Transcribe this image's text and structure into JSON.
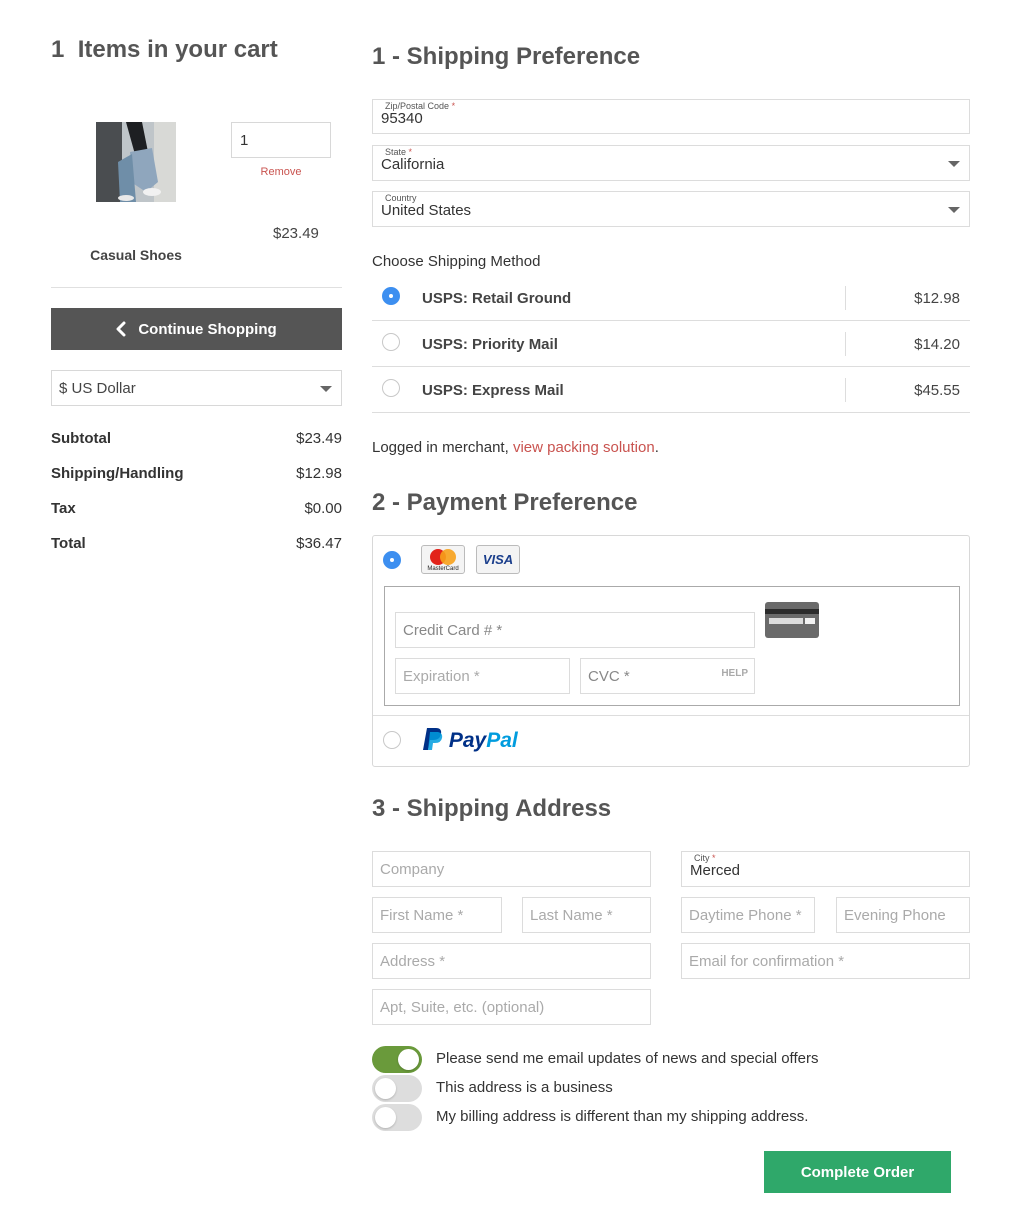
{
  "cart": {
    "count": "1",
    "title_text": "Items in your cart",
    "item": {
      "name": "Casual Shoes",
      "quantity": "1",
      "remove_label": "Remove",
      "price": "$23.49"
    },
    "continue_label": "Continue Shopping",
    "currency": "$ US Dollar",
    "totals": [
      {
        "label": "Subtotal",
        "value": "$23.49"
      },
      {
        "label": "Shipping/Handling",
        "value": "$12.98"
      },
      {
        "label": "Tax",
        "value": "$0.00"
      },
      {
        "label": "Total",
        "value": "$36.47"
      }
    ]
  },
  "shipping_pref": {
    "title": "1 - Shipping Preference",
    "zip": {
      "label": "Zip/Postal Code",
      "value": "95340"
    },
    "state": {
      "label": "State",
      "value": "California"
    },
    "country": {
      "label": "Country",
      "value": "United States"
    },
    "method_title": "Choose Shipping Method",
    "methods": [
      {
        "name": "USPS: Retail Ground",
        "price": "$12.98",
        "selected": true
      },
      {
        "name": "USPS: Priority Mail",
        "price": "$14.20",
        "selected": false
      },
      {
        "name": "USPS: Express Mail",
        "price": "$45.55",
        "selected": false
      }
    ],
    "merchant_note": "Logged in merchant, ",
    "merchant_link": "view packing solution",
    "merchant_end": "."
  },
  "payment": {
    "title": "2 - Payment Preference",
    "mastercard_label": "MasterCard",
    "visa_label": "VISA",
    "cc_placeholder": "Credit Card # *",
    "exp_placeholder": "Expiration *",
    "cvc_placeholder": "CVC *",
    "help_label": "HELP",
    "paypal_pay": "Pay",
    "paypal_pal": "Pal"
  },
  "address": {
    "title": "3 - Shipping Address",
    "company_placeholder": "Company",
    "city": {
      "label": "City",
      "value": "Merced"
    },
    "first_placeholder": "First Name *",
    "last_placeholder": "Last Name *",
    "day_phone_placeholder": "Daytime Phone *",
    "eve_phone_placeholder": "Evening Phone",
    "address_placeholder": "Address *",
    "email_placeholder": "Email for confirmation *",
    "apt_placeholder": "Apt, Suite, etc. (optional)",
    "toggles": [
      {
        "label": "Please send me email updates of news and special offers",
        "on": true
      },
      {
        "label": "This address is a business",
        "on": false
      },
      {
        "label": "My billing address is different than my shipping address.",
        "on": false
      }
    ]
  },
  "complete_label": "Complete Order",
  "colors": {
    "accent_green": "#2fa86a",
    "toggle_green": "#6a9a3b",
    "radio_blue": "#3d8ff0",
    "link_red": "#c9534f",
    "button_dark": "#555555"
  }
}
